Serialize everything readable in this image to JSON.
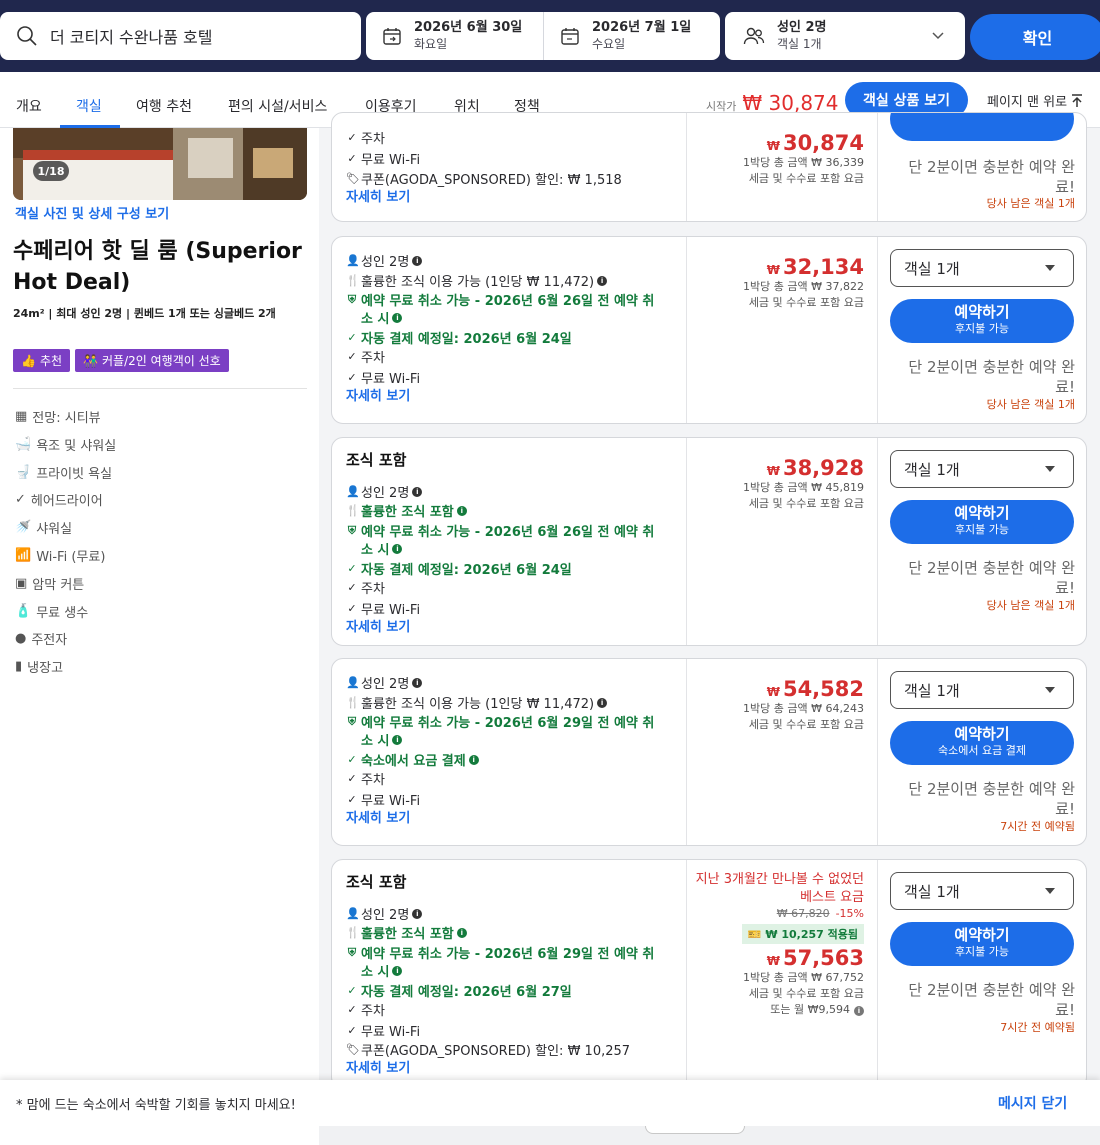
{
  "search": {
    "query": "더 코티지 수완나품 호텔",
    "checkin_date": "2026년 6월 30일",
    "checkin_day": "화요일",
    "checkout_date": "2026년 7월 1일",
    "checkout_day": "수요일",
    "guests_main": "성인 2명",
    "guests_rooms": "객실 1개",
    "confirm": "확인"
  },
  "nav": {
    "tabs": [
      "개요",
      "객실",
      "여행 추천",
      "편의 시설/서비스",
      "이용후기",
      "위치",
      "정책"
    ],
    "active_tab": "객실",
    "start_label": "시작가",
    "start_price": "₩ 30,874",
    "view_rooms": "객실 상품 보기",
    "to_top": "페이지 맨 위로"
  },
  "room": {
    "photo_counter": "1/18",
    "photo_link": "객실 사진 및 상세 구성 보기",
    "name": "수페리어 핫 딜 룸 (Superior Hot Deal)",
    "meta": "24m²  |  최대 성인 2명  |  퀸베드 1개 또는 싱글베드 2개",
    "badges": [
      "추천",
      "커플/2인 여행객이 선호"
    ],
    "amenities": [
      "전망: 시티뷰",
      "욕조 및 샤워실",
      "프라이빗 욕실",
      "헤어드라이어",
      "샤워실",
      "Wi-Fi (무료)",
      "암막 커튼",
      "무료 생수",
      "주전자",
      "냉장고"
    ]
  },
  "offers": [
    {
      "lines": [
        "주차",
        "무료 Wi-Fi",
        "쿠폰(AGODA_SPONSORED) 할인: ₩ 1,518"
      ],
      "details": "자세히 보기",
      "price": "30,874",
      "per_night": "1박당 총 금액 ₩ 36,339",
      "tax_note": "세금 및 수수료 포함 요금",
      "urgency": "단 2분이면 충분한 예약 완료!",
      "scarcity": "당사 남은 객실 1개"
    },
    {
      "lines": [
        "성인 2명",
        "훌륭한 조식 이용 가능 (1인당 ₩ 11,472)",
        "예약 무료 취소 가능 - 2026년 6월 26일 전 예약 취",
        "소 시",
        "자동 결제 예정일: 2026년 6월 24일",
        "주차",
        "무료 Wi-Fi"
      ],
      "details": "자세히 보기",
      "price": "32,134",
      "per_night": "1박당 총 금액 ₩ 37,822",
      "tax_note": "세금 및 수수료 포함 요금",
      "room_select": "객실 1개",
      "book": "예약하기",
      "book_sub": "후지불 가능",
      "urgency": "단 2분이면 충분한 예약 완료!",
      "scarcity": "당사 남은 객실 1개"
    },
    {
      "title": "조식 포함",
      "lines": [
        "성인 2명",
        "훌륭한 조식 포함",
        "예약 무료 취소 가능 - 2026년 6월 26일 전 예약 취",
        "소 시",
        "자동 결제 예정일: 2026년 6월 24일",
        "주차",
        "무료 Wi-Fi"
      ],
      "details": "자세히 보기",
      "price": "38,928",
      "per_night": "1박당 총 금액 ₩ 45,819",
      "tax_note": "세금 및 수수료 포함 요금",
      "room_select": "객실 1개",
      "book": "예약하기",
      "book_sub": "후지불 가능",
      "urgency": "단 2분이면 충분한 예약 완료!",
      "scarcity": "당사 남은 객실 1개"
    },
    {
      "lines": [
        "성인 2명",
        "훌륭한 조식 이용 가능 (1인당 ₩ 11,472)",
        "예약 무료 취소 가능 - 2026년 6월 29일 전 예약 취",
        "소 시",
        "숙소에서 요금 결제",
        "주차",
        "무료 Wi-Fi"
      ],
      "details": "자세히 보기",
      "price": "54,582",
      "per_night": "1박당 총 금액 ₩ 64,243",
      "tax_note": "세금 및 수수료 포함 요금",
      "room_select": "객실 1개",
      "book": "예약하기",
      "book_sub": "숙소에서 요금 결제",
      "urgency": "단 2분이면 충분한 예약 완료!",
      "scarcity": "7시간 전 예약됨"
    },
    {
      "title": "조식 포함",
      "lines": [
        "성인 2명",
        "훌륭한 조식 포함",
        "예약 무료 취소 가능 - 2026년 6월 29일 전 예약 취",
        "소 시",
        "자동 결제 예정일: 2026년 6월 27일",
        "주차",
        "무료 Wi-Fi",
        "쿠폰(AGODA_SPONSORED) 할인: ₩ 10,257"
      ],
      "details": "자세히 보기",
      "promo": "지난 3개월간 만나볼 수 없었던 베스트 요금",
      "original_price": "₩ 67,820",
      "discount": "-15%",
      "coupon_applied": "₩ 10,257 적용됨",
      "price": "57,563",
      "per_night": "1박당 총 금액 ₩ 67,752",
      "tax_note": "세금 및 수수료 포함 요금",
      "monthly": "또는 월 ₩9,594",
      "room_select": "객실 1개",
      "book": "예약하기",
      "book_sub": "후지불 가능",
      "urgency": "단 2분이면 충분한 예약 완료!",
      "scarcity": "7시간 전 예약됨"
    }
  ],
  "footer": {
    "message": "* 맘에 드는 숙소에서 숙박할 기회를 놓치지 마세요!",
    "close": "메시지 닫기"
  }
}
